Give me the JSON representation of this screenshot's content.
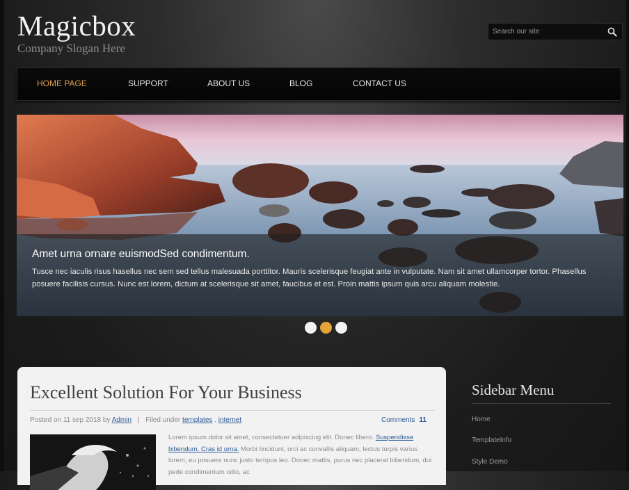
{
  "header": {
    "logo": "Magicbox",
    "slogan": "Company Slogan Here",
    "search_placeholder": "Search our site"
  },
  "nav": {
    "items": [
      {
        "label": "HOME PAGE",
        "active": true
      },
      {
        "label": "SUPPORT",
        "active": false
      },
      {
        "label": "ABOUT US",
        "active": false
      },
      {
        "label": "BLOG",
        "active": false
      },
      {
        "label": "CONTACT US",
        "active": false
      }
    ]
  },
  "slider": {
    "caption_title": "Amet urna ornare euismodSed condimentum.",
    "caption_text": "Tusce nec iaculis risus hasellus nec sem sed tellus malesuada porttitor. Mauris scelerisque feugiat ante in vulputate. Nam sit amet ullamcorper tortor. Phasellus posuere facilisis cursus. Nunc est lorem, dictum at scelerisque sit amet, faucibus et est. Proin mattis ipsum quis arcu aliquam molestie.",
    "dots": 3,
    "active_dot": 1
  },
  "post": {
    "title": "Excellent Solution For Your Business",
    "posted_on": "Posted on 11 sep 2018 by",
    "author": "Admin",
    "separator": "|",
    "filed_under": "Filed under",
    "tag1": "templates",
    "tag_sep": ",",
    "tag2": "internet",
    "comments_label": "Comments",
    "comments_count": "11",
    "body_lead": "Lorem ipsum dolor sit amet, consectetuer adipiscing elit. Donec libero.",
    "body_link": "Suspendisse bibendum. Cras id urna.",
    "body_rest": "Morbi tincidunt, orci ac convallis aliquam, lectus turpis varius lorem, eu posuere nunc justo tempus leo. Donec mattis, purus nec placerat bibendum, dui pede condimentum odio, ac"
  },
  "sidebar": {
    "title": "Sidebar Menu",
    "items": [
      "Home",
      "TemplateInfo",
      "Style Demo"
    ]
  },
  "colors": {
    "accent": "#e0a24a",
    "link": "#2d5a96",
    "panel": "#f2f2f2"
  }
}
